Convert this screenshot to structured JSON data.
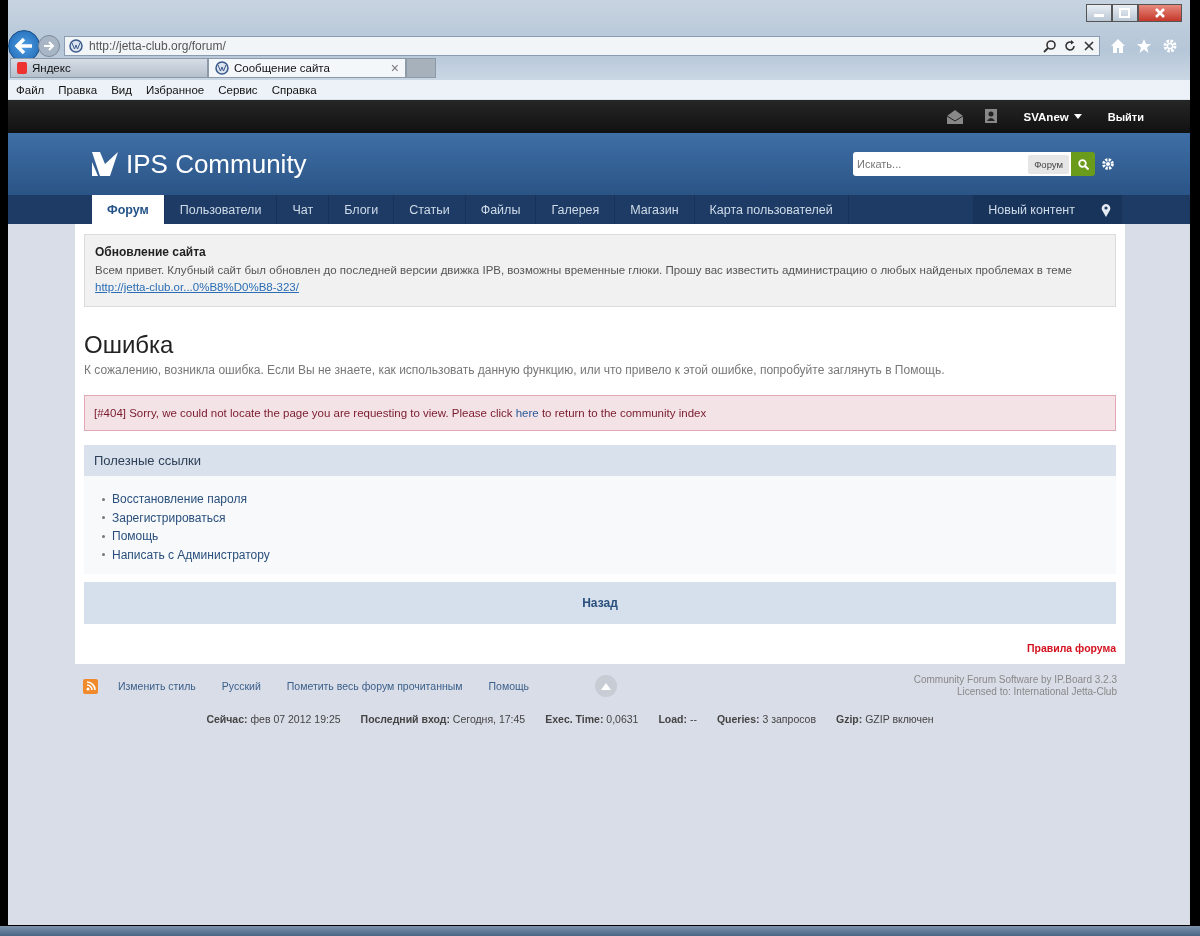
{
  "browser": {
    "url": "http://jetta-club.org/forum/",
    "tabs": [
      {
        "label": "Яндекс",
        "selected": false
      },
      {
        "label": "Сообщение сайта",
        "selected": true,
        "close": "×"
      }
    ],
    "menu": [
      "Файл",
      "Правка",
      "Вид",
      "Избранное",
      "Сервис",
      "Справка"
    ]
  },
  "user_bar": {
    "username": "SVAnew",
    "logout": "Выйти"
  },
  "header": {
    "logo": "IPS Community",
    "search_placeholder": "Искать...",
    "search_scope": "Форум"
  },
  "nav": {
    "items": [
      {
        "label": "Форум",
        "selected": true
      },
      {
        "label": "Пользователи",
        "selected": false
      },
      {
        "label": "Чат",
        "selected": false
      },
      {
        "label": "Блоги",
        "selected": false
      },
      {
        "label": "Статьи",
        "selected": false
      },
      {
        "label": "Файлы",
        "selected": false
      },
      {
        "label": "Галерея",
        "selected": false
      },
      {
        "label": "Магазин",
        "selected": false
      },
      {
        "label": "Карта пользователей",
        "selected": false
      }
    ],
    "right": "Новый контент"
  },
  "notice": {
    "title": "Обновление сайта",
    "text": "Всем привет. Клубный сайт был обновлен до последней версии движка IPB, возможны временные глюки. Прошу вас известить администрацию о любых найденых проблемах в теме ",
    "link": "http://jetta-club.or...0%B8%D0%B8-323/"
  },
  "error": {
    "title": "Ошибка",
    "description": "К сожалению, возникла ошибка. Если Вы не знаете, как использовать данную функцию, или что привело к этой ошибке, попробуйте заглянуть в Помощь.",
    "message_before": "[#404] Sorry, we could not locate the page you are requesting to view. Please click ",
    "message_link": "here",
    "message_after": " to return to the community index"
  },
  "useful_links": {
    "title": "Полезные ссылки",
    "items": [
      "Восстановление пароля",
      "Зарегистрироваться",
      "Помощь",
      "Написать с Администратору"
    ]
  },
  "back_button": "Назад",
  "rules_link": "Правила форума",
  "footer": {
    "links": [
      "Изменить стиль",
      "Русский",
      "Пометить весь форум прочитанным",
      "Помощь"
    ],
    "credits": [
      "Community Forum Software by IP.Board 3.2.3",
      "Licensed to: International Jetta-Club"
    ],
    "stats": [
      {
        "label": "Сейчас:",
        "value": "фев 07 2012 19:25"
      },
      {
        "label": "Последний вход:",
        "value": "Сегодня, 17:45"
      },
      {
        "label": "Exec. Time:",
        "value": "0,0631"
      },
      {
        "label": "Load:",
        "value": "--"
      },
      {
        "label": "Queries:",
        "value": "3 запросов"
      },
      {
        "label": "Gzip:",
        "value": "GZIP включен"
      }
    ]
  }
}
